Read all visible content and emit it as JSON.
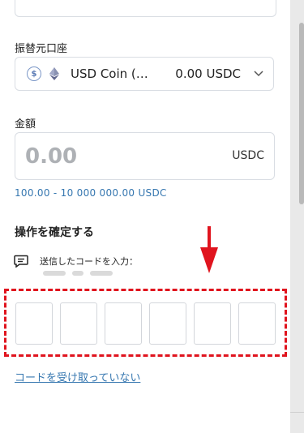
{
  "form": {
    "source_account_label": "振替元口座",
    "account": {
      "name": "USD Coin (…",
      "balance": "0.00 USDC",
      "coin_icon_glyph": "$",
      "coin_icon": "usdc-icon",
      "network_icon": "ethereum-icon"
    },
    "amount_label": "金額",
    "amount_placeholder": "0.00",
    "amount_currency": "USDC",
    "amount_range": "100.00 - 10 000 000.00 USDC"
  },
  "confirm": {
    "title": "操作を確定する",
    "code_sent_label": "送信したコードを入力：",
    "code_digits": [
      "",
      "",
      "",
      "",
      "",
      ""
    ],
    "resend_link": "コードを受け取っていない"
  },
  "colors": {
    "accent_link": "#3677b0",
    "highlight_annotation": "#e0141e",
    "placeholder_text": "#aeb1b5"
  }
}
